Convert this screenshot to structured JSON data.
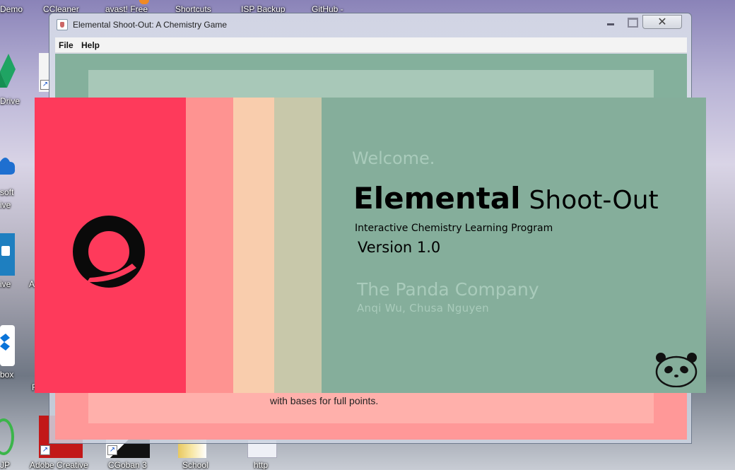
{
  "desktop": {
    "top_labels": [
      "Demo",
      "CCleaner",
      "avast! Free",
      "Shortcuts",
      "ISP Backup",
      "GitHub -"
    ],
    "left_labels": [
      "Drive",
      "soft",
      "ive",
      "ive",
      "A",
      "box",
      "F",
      "JP"
    ],
    "bottom_labels": [
      "Adobe Creative",
      "CGoban 3",
      "School",
      "http"
    ]
  },
  "window": {
    "title": "Elemental Shoot-Out: A Chemistry Game",
    "close_glyph": "✕",
    "menu": [
      "File",
      "Help"
    ],
    "background_text": "with bases for full points."
  },
  "splash": {
    "welcome": "Welcome.",
    "title_bold": "Elemental",
    "title_rest": "Shoot-Out",
    "subtitle": "Interactive Chemistry Learning Program",
    "version": "Version 1.0",
    "company": "The Panda Company",
    "authors": "Anqi Wu, Chusa Nguyen"
  },
  "colors": {
    "band_red": "#fe3a5b",
    "band_salmon": "#fe9391",
    "band_peach": "#f9cdad",
    "band_khaki": "#c8c8aa",
    "teal": "#85ae9b",
    "faded_text": "#a9cbbb"
  },
  "icons": [
    "google-drive-icon",
    "onedrive-icon",
    "blue-app-icon",
    "dropbox-icon",
    "green-app-icon",
    "red-app-icon",
    "cgoban-icon",
    "folder-icon",
    "document-icon",
    "java-icon",
    "ring-logo-icon",
    "panda-icon"
  ]
}
